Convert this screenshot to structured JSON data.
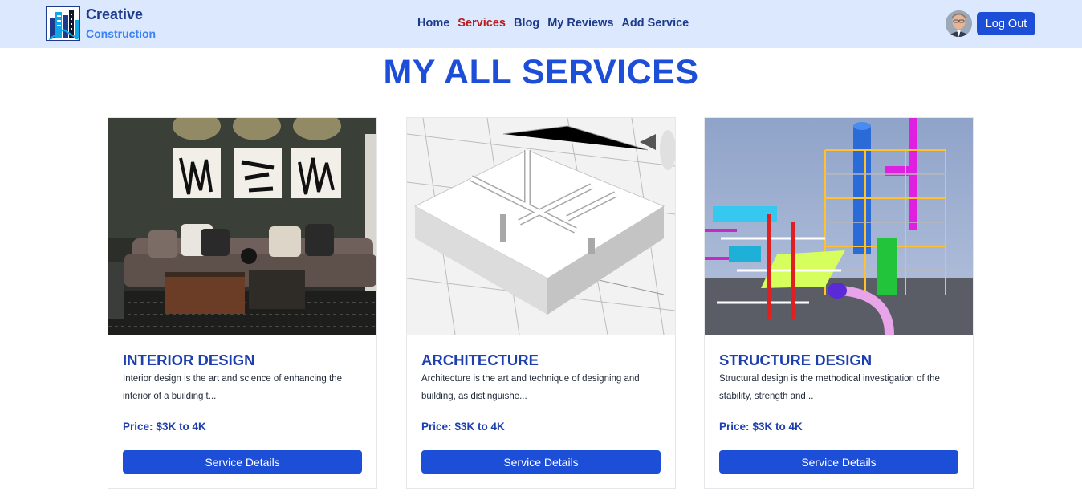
{
  "brand": {
    "title": "Creative",
    "subtitle": "Construction",
    "logo_icon": "building-logo-icon"
  },
  "nav": {
    "items": [
      {
        "label": "Home",
        "active": false
      },
      {
        "label": "Services",
        "active": true
      },
      {
        "label": "Blog",
        "active": false
      },
      {
        "label": "My Reviews",
        "active": false
      },
      {
        "label": "Add Service",
        "active": false
      }
    ],
    "logout_label": "Log Out",
    "avatar_icon": "user-avatar"
  },
  "page": {
    "title": "MY ALL SERVICES"
  },
  "services": [
    {
      "title": "INTERIOR DESIGN",
      "description": "Interior design is the art and science of enhancing the interior of a building t...",
      "price_label": "Price:",
      "price_value": "$3K to 4K",
      "button_label": "Service Details",
      "image": "living-room-photo"
    },
    {
      "title": "ARCHITECTURE",
      "description": "Architecture is the art and technique of designing and building, as distinguishe...",
      "price_label": "Price:",
      "price_value": "$3K to 4K",
      "button_label": "Service Details",
      "image": "floor-plan-model-photo"
    },
    {
      "title": "STRUCTURE DESIGN",
      "description": "Structural design is the methodical investigation of the stability, strength and...",
      "price_label": "Price:",
      "price_value": "$3K to 4K",
      "button_label": "Service Details",
      "image": "industrial-structure-render"
    }
  ],
  "colors": {
    "nav_bg": "#dbe8fd",
    "primary": "#1d4ed8",
    "heading": "#1e40af",
    "active_link": "#b91c1c"
  }
}
